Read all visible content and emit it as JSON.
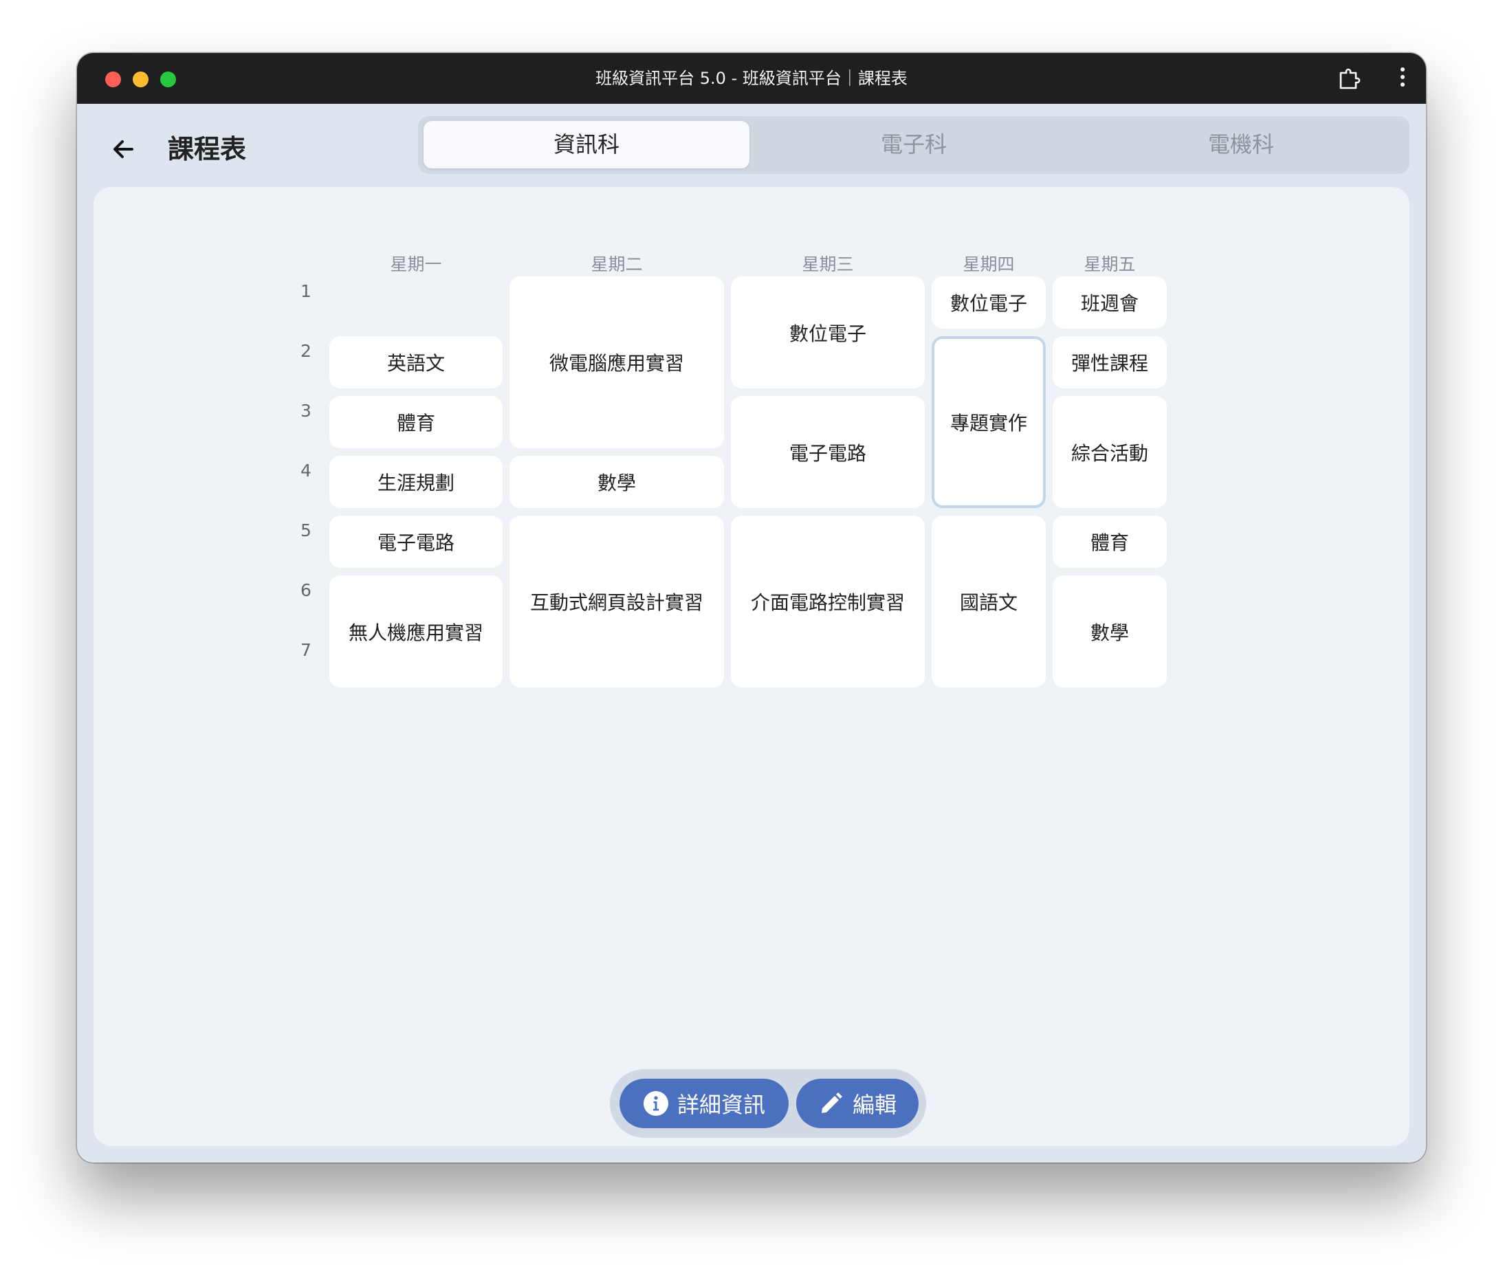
{
  "window": {
    "title": "班級資訊平台 5.0 - 班級資訊平台｜課程表"
  },
  "header": {
    "title": "課程表",
    "tabs": [
      "資訊科",
      "電子科",
      "電機科"
    ],
    "active_tab": "資訊科"
  },
  "timetable": {
    "days": [
      "星期一",
      "星期二",
      "星期三",
      "星期四",
      "星期五"
    ],
    "periods": [
      "1",
      "2",
      "3",
      "4",
      "5",
      "6",
      "7"
    ],
    "mon": [
      "英語文",
      "體育",
      "生涯規劃",
      "電子電路",
      "無人機應用實習"
    ],
    "tue": [
      "微電腦應用實習",
      "數學",
      "互動式網頁設計實習"
    ],
    "wed": [
      "數位電子",
      "電子電路",
      "介面電路控制實習"
    ],
    "thu": [
      "數位電子",
      "專題實作",
      "國語文"
    ],
    "fri": [
      "班週會",
      "彈性課程",
      "綜合活動",
      "體育",
      "數學"
    ],
    "selected_course": "專題實作"
  },
  "actions": {
    "info_label": "詳細資訊",
    "edit_label": "編輯"
  },
  "colors": {
    "accent": "#4c70c0",
    "titlebar": "#1f1f1f",
    "background": "#dfe5ee",
    "panel": "#eff3f8"
  }
}
